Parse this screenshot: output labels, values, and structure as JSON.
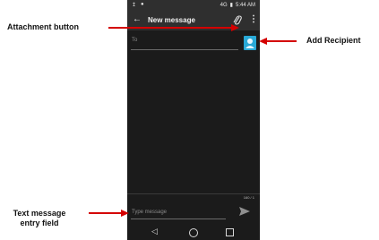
{
  "status_bar": {
    "left_icons": [
      "↥",
      "●"
    ],
    "signal": "4G",
    "battery": "▮",
    "time": "5:44 AM"
  },
  "app_bar": {
    "title": "New message",
    "back_icon": "arrow-back-icon",
    "attach_icon": "paperclip-icon",
    "menu_icon": "more-vert-icon"
  },
  "compose": {
    "to_placeholder": "To",
    "add_recipient_icon": "contact-add-icon",
    "char_counter": "160 / 1",
    "message_placeholder": "Type message",
    "send_icon": "send-icon"
  },
  "nav": {
    "back": "◁",
    "home": "home-circle-icon",
    "recents": "recents-square-icon"
  },
  "annotations": {
    "attachment_button": "Attachment button",
    "add_recipient": "Add Recipient",
    "text_entry_line1": "Text message",
    "text_entry_line2": "entry field"
  },
  "colors": {
    "annotation": "#d40000",
    "app_bar": "#2f2f2f",
    "screen": "#1b1b1b",
    "accent": "#29a9d7"
  }
}
